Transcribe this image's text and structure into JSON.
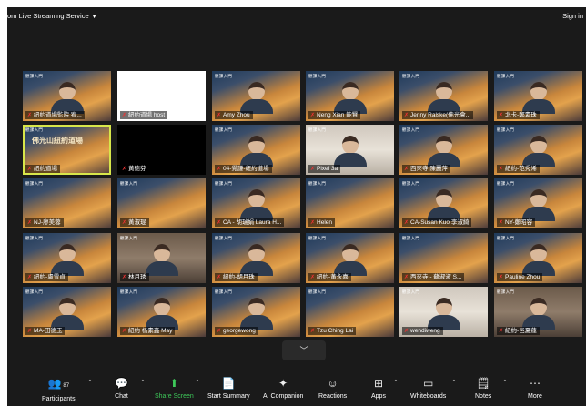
{
  "window": {
    "title": "om Live Streaming Service",
    "signin": "Sign in"
  },
  "tile_badge": "觀課入門",
  "tiles": [
    {
      "name": "紐約道場監院 宥...",
      "style": "person"
    },
    {
      "name": "紐約道場 host",
      "style": "white"
    },
    {
      "name": "Amy Zhou",
      "style": "person"
    },
    {
      "name": "Neng Xian 能賢",
      "style": "person"
    },
    {
      "name": "Jenny Ralske(佛光會...",
      "style": "person"
    },
    {
      "name": "北卡-鄭素珠",
      "style": "person"
    },
    {
      "name": "紐約道場",
      "style": "logo",
      "logo_text": "佛光山紐約道場"
    },
    {
      "name": "黃德芬",
      "style": "black"
    },
    {
      "name": "04-覺謙-紐約道場",
      "style": "person"
    },
    {
      "name": "Pixel 3a",
      "style": "room"
    },
    {
      "name": "西來寺 陳麗萍",
      "style": "person"
    },
    {
      "name": "紐約-范秀浠",
      "style": "person"
    },
    {
      "name": "NJ-廖美蓉",
      "style": "plain"
    },
    {
      "name": "黃淑琨",
      "style": "plain"
    },
    {
      "name": "CA - 胡瑞娟 Laura H...",
      "style": "person"
    },
    {
      "name": "Helen",
      "style": "plain"
    },
    {
      "name": "CA-Susan Kuo 李淑綺",
      "style": "person"
    },
    {
      "name": "NY-鄭昭容",
      "style": "person"
    },
    {
      "name": "紐約-盧雪貞",
      "style": "person"
    },
    {
      "name": "林月琇",
      "style": "photo"
    },
    {
      "name": "紐約-胡月珠",
      "style": "person"
    },
    {
      "name": "紐約-黃永嘉",
      "style": "person"
    },
    {
      "name": "西來寺 - 蘇淑淑 S...",
      "style": "plain"
    },
    {
      "name": "Pauline Zhou",
      "style": "person"
    },
    {
      "name": "MA-田德玉",
      "style": "person"
    },
    {
      "name": "紐約 杨素鑫 May",
      "style": "person"
    },
    {
      "name": "georgewong",
      "style": "person"
    },
    {
      "name": "Tzu Ching Lai",
      "style": "plain"
    },
    {
      "name": "wendiweng",
      "style": "room"
    },
    {
      "name": "紐約-邑夏蓮",
      "style": "photo"
    }
  ],
  "collapse_icon": "chevron-down-icon",
  "toolbar": {
    "participants": {
      "label": "Participants",
      "count": "87"
    },
    "chat": "Chat",
    "share_screen": "Share Screen",
    "start_summary": "Start Summary",
    "ai_companion": "AI Companion",
    "reactions": "Reactions",
    "apps": "Apps",
    "whiteboards": "Whiteboards",
    "notes": "Notes",
    "more": "More"
  },
  "colors": {
    "active_speaker": "#d7e64a",
    "share_green": "#3ec95a",
    "mic_muted": "#e33"
  }
}
